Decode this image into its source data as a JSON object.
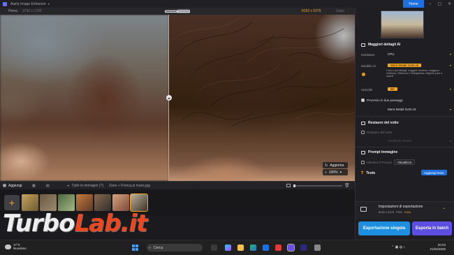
{
  "window": {
    "app_title": "Aiarty Image Enhancer",
    "home_label": "Home"
  },
  "compare": {
    "left_label": "Piena",
    "left_size": "3730 x 1760",
    "right_size": "8192 x 5376",
    "right_label": "Dopo"
  },
  "preview": {
    "refresh_label": "Aggiorna",
    "zoom_label": "100%"
  },
  "gallery": {
    "add_label": "Aggiungi",
    "all_images_label": "Tutte le immagini (7)",
    "file_name": "Zane + Frency.ai mans.jpg",
    "add_symbol": "+"
  },
  "panel": {
    "details_title": "Maggiori dettagli AI",
    "hardware_label": "Hardware",
    "hardware_value": "CPU",
    "model_label": "Modello AI",
    "model_value": "More-Detail GAN v2",
    "model_desc": "Crea e più dettagli, maggiori strutture, maggiore nitidezza, Nitidezza e Dettaglistica, Migliore para a capelli",
    "scale_label": "Upscale",
    "scale_value": "8K",
    "two_step_label": "Processo in due passaggi",
    "two_step_value": "More-Detail GAN v3",
    "face_title": "Restauro del volto",
    "face_check_label": "Restauro del volto",
    "face_select_value": "Gradiente Diretto",
    "prompt_title": "Prompt immagine",
    "prompt_check_label": "Mantieni il Prompt",
    "view_label": "Visualizza",
    "text_title": "Testo",
    "add_text_label": "Aggiungi testo",
    "export_title": "Impostazioni di esportazione",
    "export_size": "8192 x 5376",
    "export_format": "PNG",
    "export_bits": "8 bits",
    "export_single": "Esportazione singola",
    "export_batch": "Esporta in batch"
  },
  "watermark": {
    "part1": "Turbo",
    "part2": "Lab.it"
  },
  "taskbar": {
    "temperature": "17°C",
    "weather": "Nuvoloso",
    "search_label": "Cerca",
    "time": "20:23",
    "date": "21/04/2025"
  },
  "colors": {
    "accent": "#f5a524",
    "blue": "#1e6fe0",
    "purple": "#5b4ee0"
  }
}
